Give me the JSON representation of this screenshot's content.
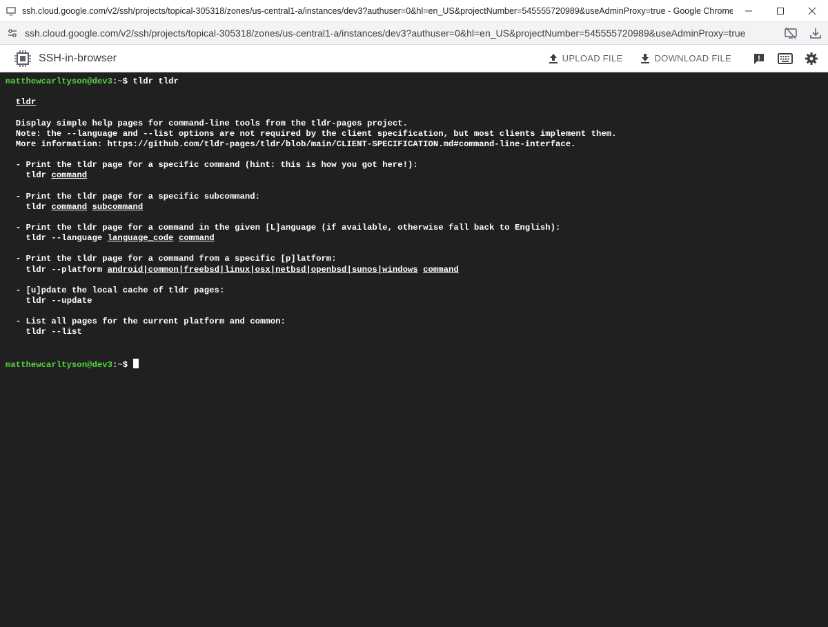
{
  "window": {
    "title": "ssh.cloud.google.com/v2/ssh/projects/topical-305318/zones/us-central1-a/instances/dev3?authuser=0&hl=en_US&projectNumber=545555720989&useAdminProxy=true - Google Chrome",
    "favicon_icon": "ssh-terminal-icon",
    "controls": [
      "minimize-icon",
      "maximize-icon",
      "close-icon"
    ]
  },
  "addressbar": {
    "url": "ssh.cloud.google.com/v2/ssh/projects/topical-305318/zones/us-central1-a/instances/dev3?authuser=0&hl=en_US&projectNumber=545555720989&useAdminProxy=true"
  },
  "toolbar": {
    "app_title": "SSH-in-browser",
    "upload_label": "UPLOAD FILE",
    "download_label": "DOWNLOAD FILE"
  },
  "terminal": {
    "prompt_user": "matthewcarltyson@dev3",
    "prompt_sep": ":",
    "prompt_path": "~",
    "prompt_symbol": "$ ",
    "command": "tldr tldr",
    "page_title": "tldr",
    "description": [
      "Display simple help pages for command-line tools from the tldr-pages project.",
      "Note: the --language and --list options are not required by the client specification, but most clients implement them.",
      "More information: https://github.com/tldr-pages/tldr/blob/main/CLIENT-SPECIFICATION.md#command-line-interface."
    ],
    "examples": [
      {
        "desc": "- Print the tldr page for a specific command (hint: this is how you got here!):",
        "cmd": [
          {
            "t": "tldr ",
            "u": false
          },
          {
            "t": "command",
            "u": true
          }
        ]
      },
      {
        "desc": "- Print the tldr page for a specific subcommand:",
        "cmd": [
          {
            "t": "tldr ",
            "u": false
          },
          {
            "t": "command",
            "u": true
          },
          {
            "t": " ",
            "u": false
          },
          {
            "t": "subcommand",
            "u": true
          }
        ]
      },
      {
        "desc": "- Print the tldr page for a command in the given [L]anguage (if available, otherwise fall back to English):",
        "cmd": [
          {
            "t": "tldr --language ",
            "u": false
          },
          {
            "t": "language_code",
            "u": true
          },
          {
            "t": " ",
            "u": false
          },
          {
            "t": "command",
            "u": true
          }
        ]
      },
      {
        "desc": "- Print the tldr page for a command from a specific [p]latform:",
        "cmd": [
          {
            "t": "tldr --platform ",
            "u": false
          },
          {
            "t": "android|common|freebsd|linux|osx|netbsd|openbsd|sunos|windows",
            "u": true
          },
          {
            "t": " ",
            "u": false
          },
          {
            "t": "command",
            "u": true
          }
        ]
      },
      {
        "desc": "- [u]pdate the local cache of tldr pages:",
        "cmd": [
          {
            "t": "tldr --update",
            "u": false
          }
        ]
      },
      {
        "desc": "- List all pages for the current platform and common:",
        "cmd": [
          {
            "t": "tldr --list",
            "u": false
          }
        ]
      }
    ]
  }
}
